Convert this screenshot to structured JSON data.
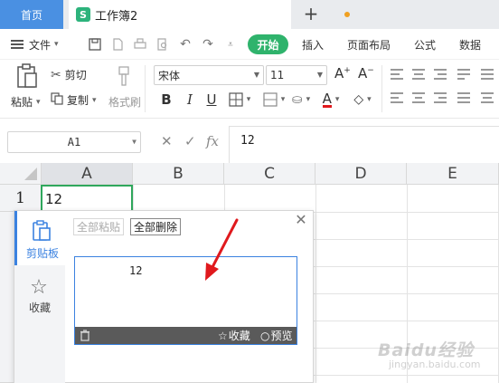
{
  "tabs": {
    "home": "首页",
    "doc_icon": "S",
    "doc": "工作簿2",
    "add": "+"
  },
  "menubar": {
    "file": "文件",
    "items": [
      "开始",
      "插入",
      "页面布局",
      "公式",
      "数据"
    ]
  },
  "ribbon": {
    "paste": "粘贴",
    "cut": "剪切",
    "copy": "复制",
    "format_painter": "格式刷",
    "font_name": "宋体",
    "font_size": "11",
    "bold": "B",
    "italic": "I",
    "underline": "U",
    "grow_font": "A⁺",
    "shrink_font": "A⁻",
    "font_color": "A"
  },
  "formula_bar": {
    "name_box": "A1",
    "cancel": "✕",
    "confirm": "✓",
    "fx": "fx",
    "content": "12"
  },
  "grid": {
    "columns": [
      "A",
      "B",
      "C",
      "D",
      "E"
    ],
    "rows": [
      "1"
    ],
    "a1_value": "12"
  },
  "clipboard": {
    "tab_clipboard": "剪贴板",
    "tab_favorites": "收藏",
    "paste_all": "全部粘贴",
    "delete_all": "全部删除",
    "item_text": "12",
    "favorite": "收藏",
    "preview": "预览"
  },
  "watermark": {
    "brand": "Baidu经验",
    "url": "jingyan.baidu.com"
  },
  "colors": {
    "accent_green": "#2fb36c",
    "accent_blue": "#3b82e0",
    "home_tab": "#4a90e2",
    "arrow_red": "#e0191d"
  }
}
